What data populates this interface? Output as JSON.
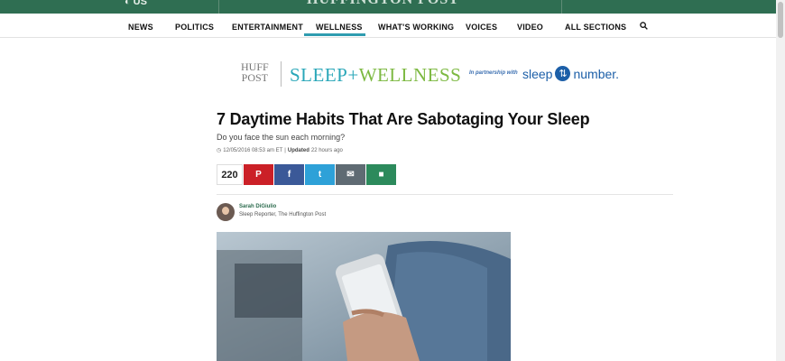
{
  "header": {
    "edition": "US",
    "masthead": "HUFFINGTON POST"
  },
  "nav": {
    "items": [
      "NEWS",
      "POLITICS",
      "ENTERTAINMENT",
      "WELLNESS",
      "WHAT'S WORKING",
      "VOICES",
      "VIDEO",
      "ALL SECTIONS"
    ],
    "active": "WELLNESS",
    "search_icon": "search-icon"
  },
  "brand": {
    "huff_line1": "HUFF",
    "huff_line2": "POST",
    "section_part1": "SLEEP+",
    "section_part2": "WELLNESS",
    "partner_text": "In partnership with",
    "partner_word1": "sleep",
    "partner_mark": "⇅",
    "partner_word2": "number."
  },
  "article": {
    "headline": "7 Daytime Habits That Are Sabotaging Your Sleep",
    "subheadline": "Do you face the sun each morning?",
    "date": "12/05/2016 08:53 am ET",
    "updated_label": "Updated",
    "updated_ago": "22 hours ago"
  },
  "share": {
    "count": "220",
    "buttons": [
      {
        "name": "pinterest",
        "glyph": "P",
        "color": "#cb2027"
      },
      {
        "name": "facebook",
        "glyph": "f",
        "color": "#3b5998"
      },
      {
        "name": "twitter",
        "glyph": "t",
        "color": "#2ea1d8"
      },
      {
        "name": "email",
        "glyph": "✉",
        "color": "#5f6b73"
      },
      {
        "name": "comment",
        "glyph": "■",
        "color": "#2c8a5c"
      }
    ]
  },
  "author": {
    "name": "Sarah DiGiulio",
    "role": "Sleep Reporter, The Huffington Post"
  },
  "colors": {
    "topbar": "#2f6e52",
    "accent": "#2f9cb0",
    "sleep": "#2aa7b9",
    "wellness": "#7db942"
  }
}
